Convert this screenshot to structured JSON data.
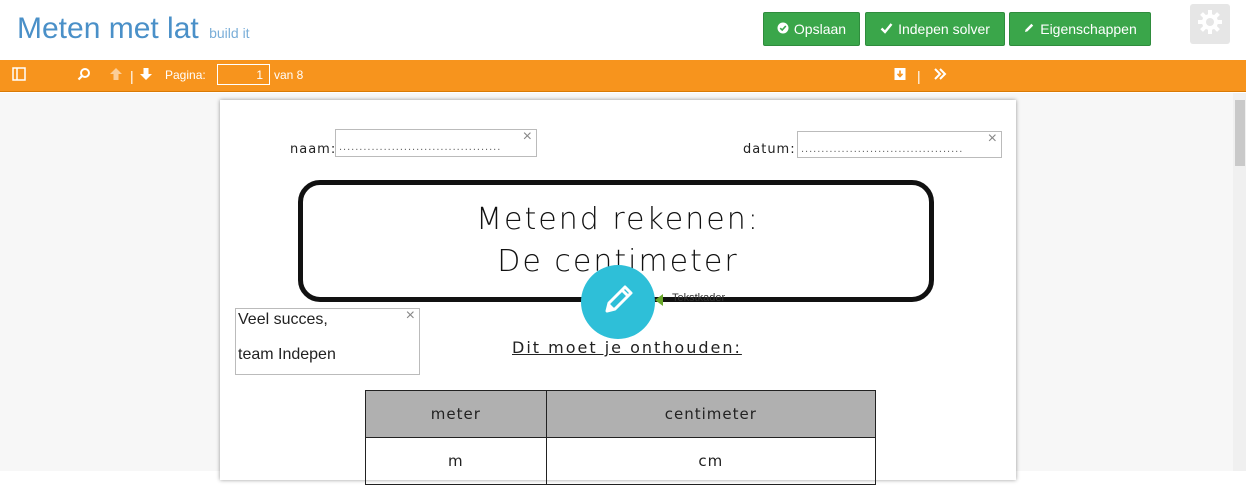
{
  "header": {
    "title": "Meten met lat",
    "subtitle": "build it",
    "buttons": {
      "save": "Opslaan",
      "solver": "Indepen solver",
      "properties": "Eigenschappen"
    }
  },
  "toolbar": {
    "page_label": "Pagina:",
    "page_value": "1",
    "of_label": "van 8"
  },
  "document": {
    "name_label": "naam:",
    "name_dots": "........................................",
    "date_label": "datum:",
    "date_dots": "........................................",
    "heading_line1": "Metend rekenen:",
    "heading_line2": "De centimeter",
    "textbox_line1": "Veel succes,",
    "textbox_line2": "team Indepen",
    "remember": "Dit moet je onthouden:",
    "tooltip": "Tekstkader",
    "table": {
      "headers": [
        "meter",
        "centimeter"
      ],
      "rows": [
        [
          "m",
          "cm"
        ]
      ]
    }
  },
  "colors": {
    "accent_title": "#4a90c8",
    "button_green": "#3aa64a",
    "toolbar_orange": "#f7941d",
    "pencil_cyan": "#2ebfd8"
  }
}
